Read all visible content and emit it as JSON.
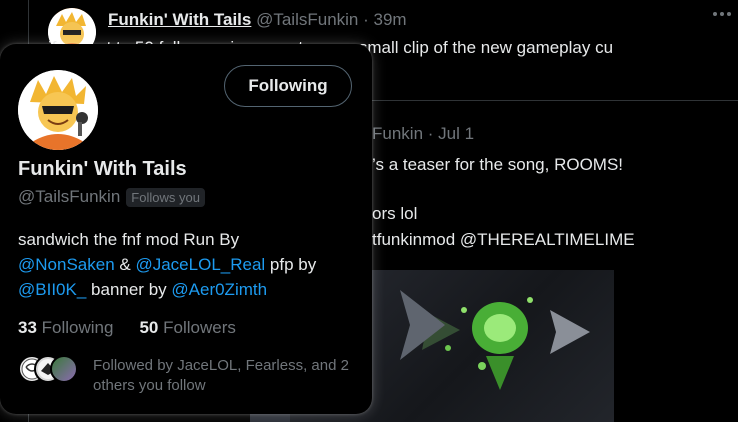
{
  "tweet1": {
    "name": "Funkin' With Tails",
    "handle": "@TailsFunkin",
    "time": "· 39m",
    "text": "if we get to 50 followers i can post a very small clip of the new gameplay cu"
  },
  "tweet2": {
    "header_partial": "Funkin · Jul 1",
    "line1": "’s a teaser for the song, ROOMS!",
    "line2": "ors lol",
    "line3": "tfunkinmod @THEREALTIMELIME"
  },
  "card": {
    "follow_button_label": "Following",
    "name": "Funkin' With Tails",
    "handle": "@TailsFunkin",
    "follows_you": "Follows you",
    "bio": {
      "part1": "sandwich the fnf mod Run By",
      "link1": "@NonSaken",
      "amp": "&",
      "link2": "@JaceLOL_Real",
      "part2": "pfp by",
      "link3": "@BII0K_",
      "part3": "banner by",
      "link4": "@Aer0Zimth"
    },
    "following_count": "33",
    "following_label": "Following",
    "followers_count": "50",
    "followers_label": "Followers",
    "followed_by_text": "Followed by JaceLOL, Fearless, and 2 others you follow"
  },
  "icons": {
    "more": "more-dots-icon"
  },
  "colors": {
    "background": "#000000",
    "link": "#1d9bf0",
    "muted": "#71767b",
    "border": "#2f3336"
  }
}
